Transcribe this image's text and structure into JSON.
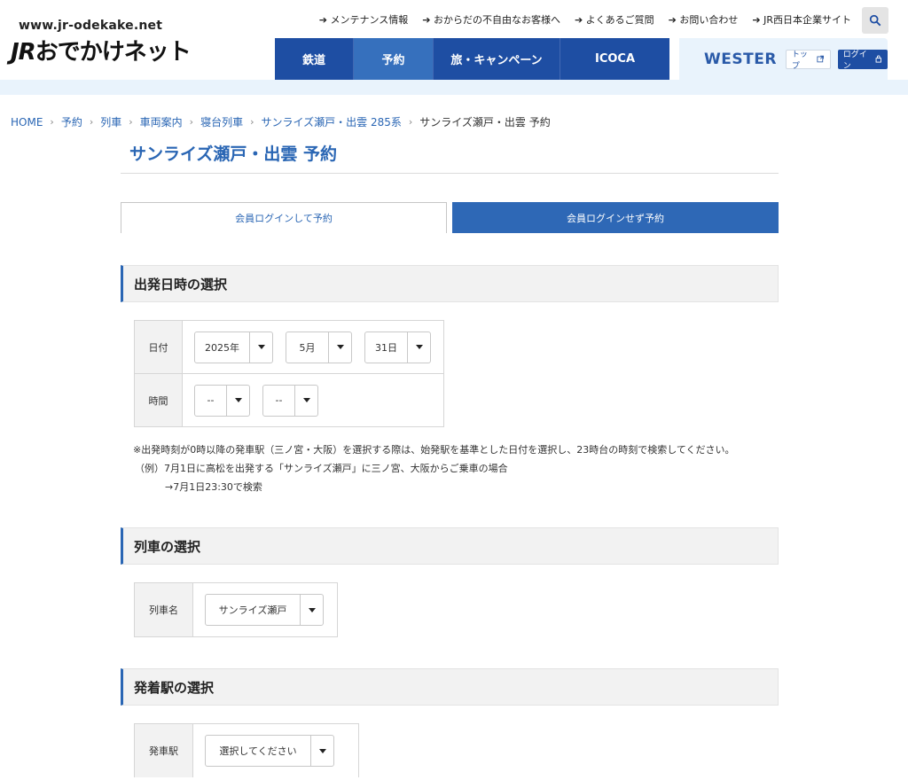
{
  "header": {
    "site_url": "www.jr-odekake.net",
    "logo_jr": "JR",
    "logo_rest": "おでかけネット",
    "util_links": [
      "メンテナンス情報",
      "おからだの不自由なお客様へ",
      "よくあるご質問",
      "お問い合わせ",
      "JR西日本企業サイト"
    ],
    "nav": [
      {
        "label": "鉄道",
        "active": false
      },
      {
        "label": "予約",
        "active": true
      },
      {
        "label": "旅・キャンペーン",
        "active": false
      },
      {
        "label": "ICOCA",
        "active": false
      }
    ],
    "wester": {
      "brand": "WESTER",
      "top_label": "トップ",
      "login_label": "ログイン"
    }
  },
  "breadcrumb": [
    "HOME",
    "予約",
    "列車",
    "車両案内",
    "寝台列車",
    "サンライズ瀬戸・出雲 285系",
    "サンライズ瀬戸・出雲 予約"
  ],
  "page_title": "サンライズ瀬戸・出雲 予約",
  "tabs": {
    "login": "会員ログインして予約",
    "guest": "会員ログインせず予約"
  },
  "sections": {
    "datetime": {
      "heading": "出発日時の選択",
      "date_label": "日付",
      "year": "2025年",
      "month": "5月",
      "day": "31日",
      "time_label": "時間",
      "hour": "--",
      "minute": "--",
      "note1": "※出発時刻が0時以降の発車駅（三ノ宮・大阪）を選択する際は、始発駅を基準とした日付を選択し、23時台の時刻で検索してください。",
      "note2": "（例）7月1日に高松を出発する「サンライズ瀬戸」に三ノ宮、大阪からご乗車の場合",
      "note3": "→7月1日23:30で検索"
    },
    "train": {
      "heading": "列車の選択",
      "label": "列車名",
      "value": "サンライズ瀬戸"
    },
    "stations": {
      "heading": "発着駅の選択",
      "depart_label": "発車駅",
      "depart_value": "選択してください"
    }
  },
  "colors": {
    "brand_blue": "#1e4ea3",
    "link_blue": "#2a66b4",
    "light_blue_bg": "#e9f3fc"
  }
}
